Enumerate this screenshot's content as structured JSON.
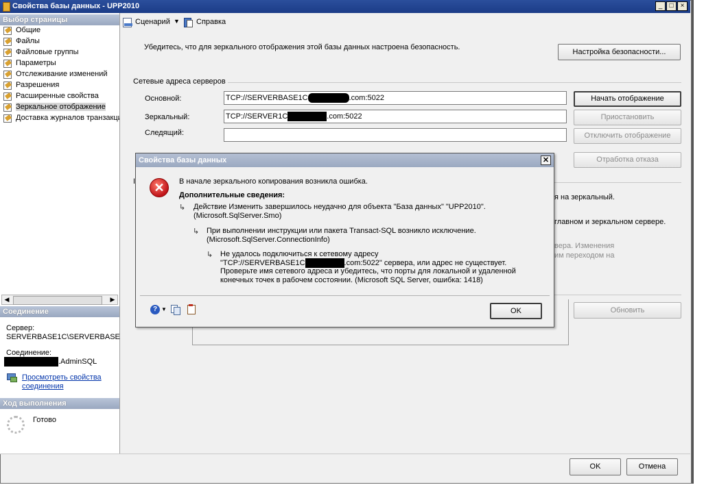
{
  "window": {
    "title": "Свойства базы данных - UPP2010",
    "buttons": [
      "_",
      "□",
      "×"
    ]
  },
  "sidebar": {
    "page_select_header": "Выбор страницы",
    "items": [
      {
        "label": "Общие"
      },
      {
        "label": "Файлы"
      },
      {
        "label": "Файловые группы"
      },
      {
        "label": "Параметры"
      },
      {
        "label": "Отслеживание изменений"
      },
      {
        "label": "Разрешения"
      },
      {
        "label": "Расширенные свойства"
      },
      {
        "label": "Зеркальное отображение"
      },
      {
        "label": "Доставка журналов транзакций"
      }
    ],
    "selected_item": "Зеркальное отображение",
    "connection_header": "Соединение",
    "server_label": "Сервер:",
    "server_value": "SERVERBASE1C\\SERVERBASE",
    "connection_label": "Соединение:",
    "connection_value": ".AdminSQL",
    "view_props_link": "Просмотреть свойства соединения",
    "progress_header": "Ход выполнения",
    "progress_status": "Готово"
  },
  "toolbar": {
    "script_label": "Сценарий",
    "help_label": "Справка"
  },
  "main": {
    "security_note": "Убедитесь, что для зеркального отображения этой базы данных настроена безопасность.",
    "security_button": "Настройка безопасности...",
    "server_addresses_group": "Сетевые адреса серверов",
    "principal_label": "Основной:",
    "principal_value_prefix": "TCP://SERVERBASE1C",
    "principal_value_suffix": ".com:5022",
    "mirror_label": "Зеркальный:",
    "mirror_value_prefix": "TCP://SERVER1C",
    "mirror_value_suffix": ".com:5022",
    "witness_label": "Следящий:",
    "witness_value": "",
    "start_mirroring_button": "Начать отображение",
    "pause_button": "Приостановить",
    "remove_mirroring_button": "Отключить отображение",
    "failover_button": "Отработка отказа",
    "bg_text_1": "я на зеркальный.",
    "bg_text_2": "главном и зеркальном сервере.",
    "bg_text_3": "вера. Изменения",
    "bg_text_4": "им переходом на",
    "refresh_button": "Обновить",
    "ok_button": "OK",
    "cancel_button": "Отмена"
  },
  "dialog": {
    "title": "Свойства базы данных",
    "message": "В начале зеркального копирования возникла ошибка.",
    "details_header": "Дополнительные сведения:",
    "detail_1_line_1": "Действие Изменить завершилось неудачно для объекта \"База данных\" \"UPP2010\".",
    "detail_1_line_2": "(Microsoft.SqlServer.Smo)",
    "detail_2_line_1": "При выполнении инструкции или пакета Transact-SQL возникло исключение.",
    "detail_2_line_2": "(Microsoft.SqlServer.ConnectionInfo)",
    "detail_3_line_1": "Не удалось подключиться к сетевому адресу",
    "detail_3_line_2_prefix": "\"TCP://SERVERBASE1C",
    "detail_3_line_2_suffix": ".com:5022\" сервера, или адрес не существует.",
    "detail_3_line_3": "Проверьте имя сетевого адреса и убедитесь, что порты для локальной и удаленной",
    "detail_3_line_4": "конечных точек в рабочем состоянии. (Microsoft SQL Server, ошибка: 1418)",
    "ok_button": "OK"
  }
}
